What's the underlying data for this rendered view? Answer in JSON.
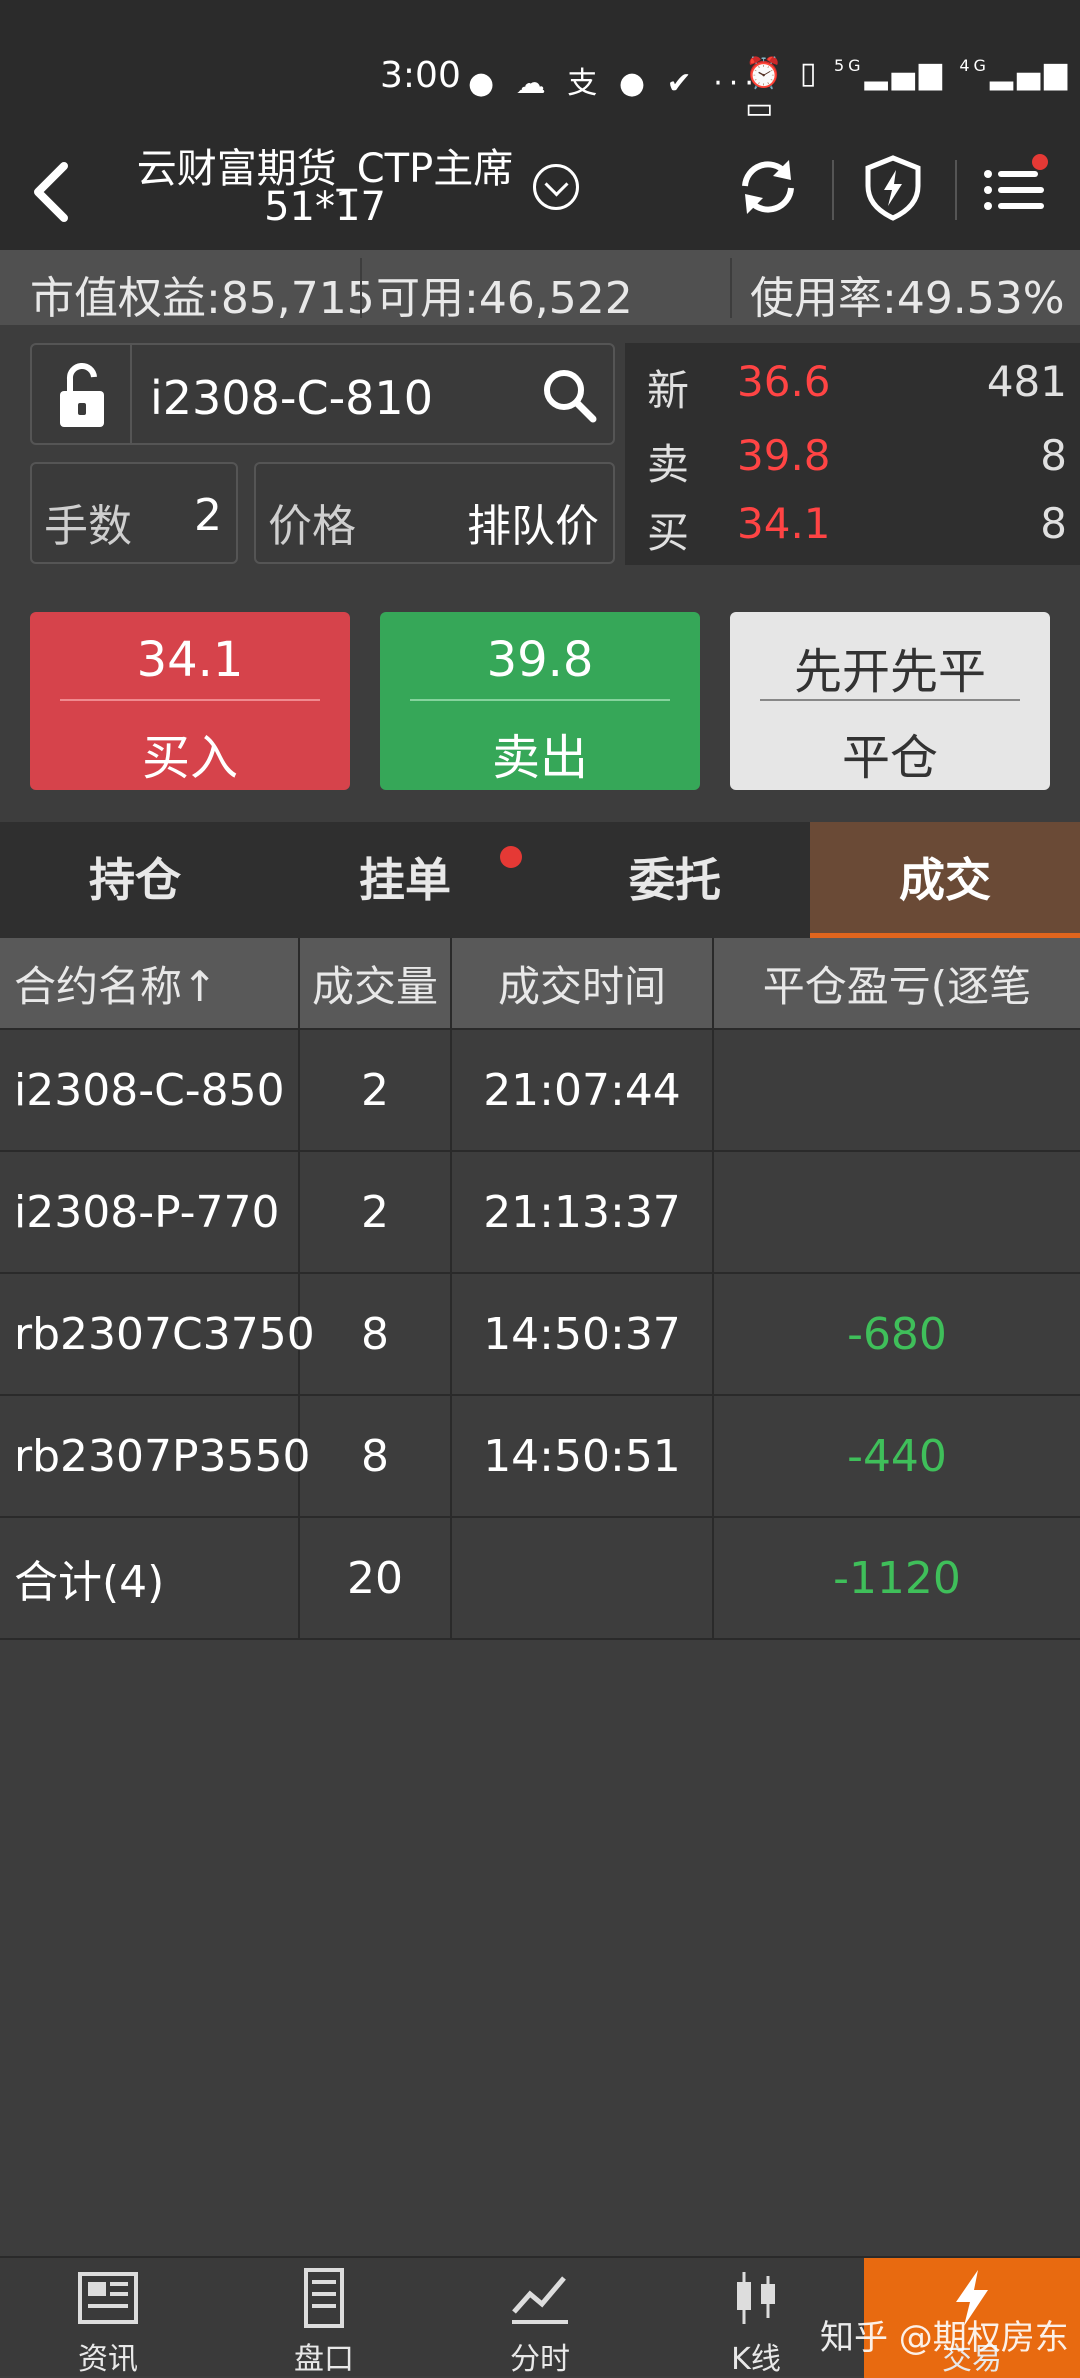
{
  "status_bar": {
    "time": "3:00",
    "network_left": "5G",
    "network_right": "4G"
  },
  "header": {
    "title_line1": "云财富期货_CTP主席",
    "title_line2": "51*17"
  },
  "account": {
    "market_value": "市值权益:85,715",
    "available": "可用:46,522",
    "usage": "使用率:49.53%"
  },
  "order": {
    "symbol": "i2308-C-810",
    "qty_label": "手数",
    "qty_value": "2",
    "price_label": "价格",
    "price_value": "排队价"
  },
  "quote": {
    "last_label": "新",
    "last_price": "36.6",
    "last_vol": "481",
    "ask_label": "卖",
    "ask_price": "39.8",
    "ask_vol": "8",
    "bid_label": "买",
    "bid_price": "34.1",
    "bid_vol": "8"
  },
  "buttons": {
    "buy_price": "34.1",
    "buy_label": "买入",
    "sell_price": "39.8",
    "sell_label": "卖出",
    "close_mode": "先开先平",
    "close_label": "平仓"
  },
  "tabs": [
    "持仓",
    "挂单",
    "委托",
    "成交"
  ],
  "table": {
    "headers": [
      "合约名称↑",
      "成交量",
      "成交时间",
      "平仓盈亏(逐笔"
    ],
    "rows": [
      {
        "name": "i2308-C-850",
        "qty": "2",
        "time": "21:07:44",
        "pnl": ""
      },
      {
        "name": "i2308-P-770",
        "qty": "2",
        "time": "21:13:37",
        "pnl": ""
      },
      {
        "name": "rb2307C3750",
        "qty": "8",
        "time": "14:50:37",
        "pnl": "-680"
      },
      {
        "name": "rb2307P3550",
        "qty": "8",
        "time": "14:50:51",
        "pnl": "-440"
      },
      {
        "name": "合计(4)",
        "qty": "20",
        "time": "",
        "pnl": "-1120"
      }
    ]
  },
  "bottom_nav": [
    "资讯",
    "盘口",
    "分时",
    "K线",
    "交易"
  ],
  "watermark": "知乎 @期权房东",
  "colors": {
    "buy": "#d6434b",
    "sell": "#36a758",
    "loss": "#3fbf5a",
    "accent": "#e86a10"
  }
}
